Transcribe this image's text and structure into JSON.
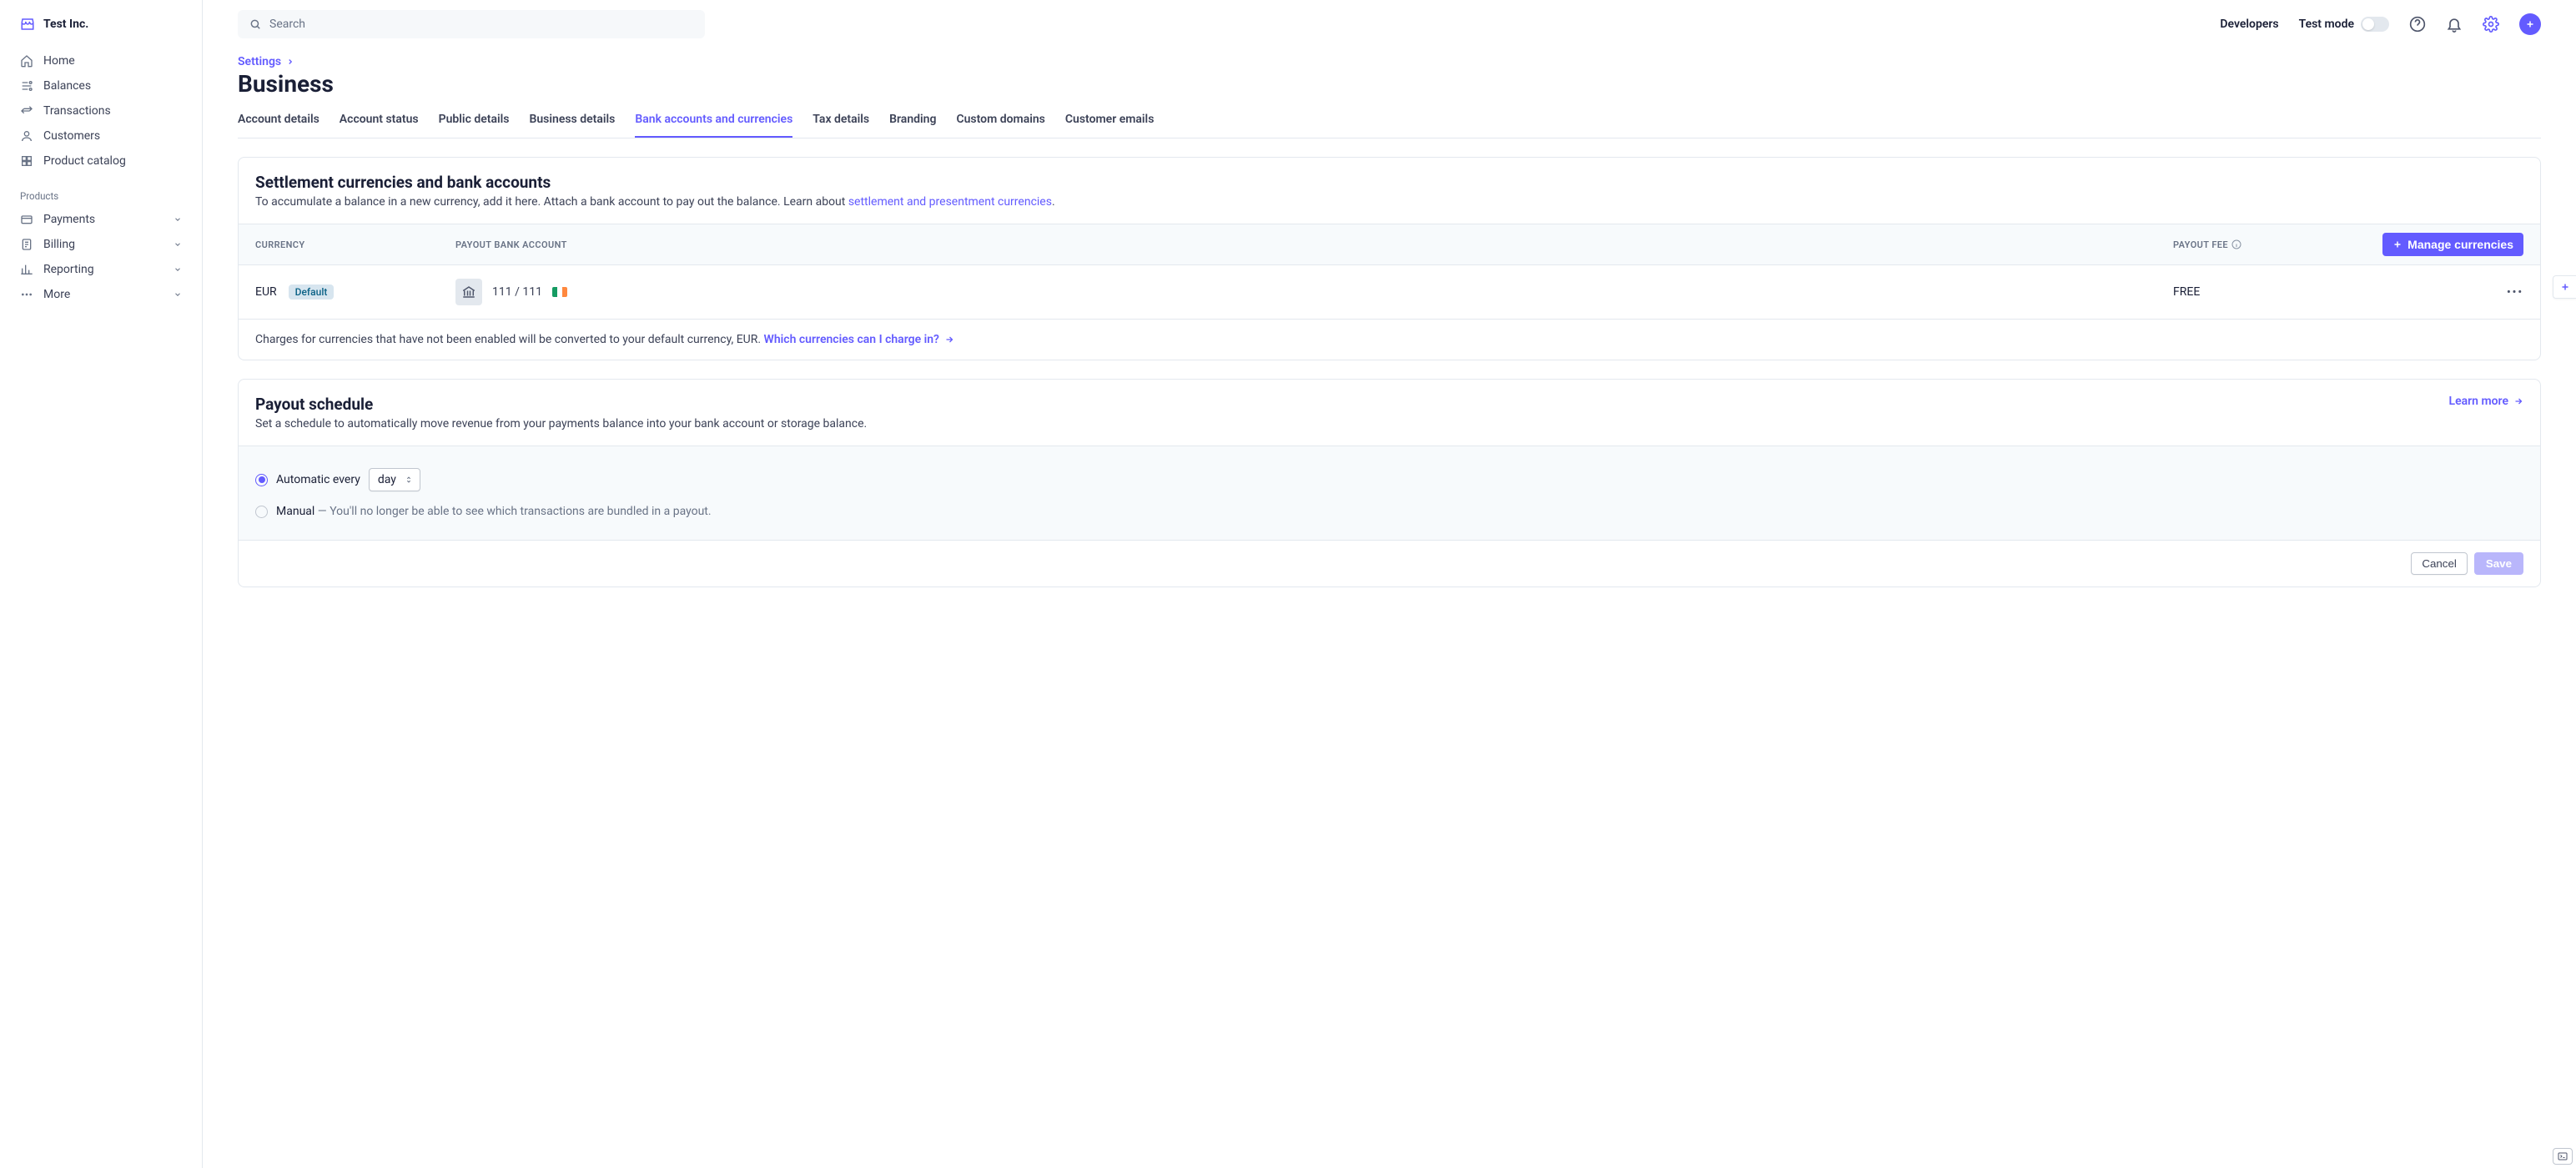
{
  "org_name": "Test Inc.",
  "search": {
    "placeholder": "Search"
  },
  "topbar": {
    "developers": "Developers",
    "test_mode": "Test mode"
  },
  "sidebar": {
    "items": [
      {
        "label": "Home"
      },
      {
        "label": "Balances"
      },
      {
        "label": "Transactions"
      },
      {
        "label": "Customers"
      },
      {
        "label": "Product catalog"
      }
    ],
    "products_label": "Products",
    "products": [
      {
        "label": "Payments"
      },
      {
        "label": "Billing"
      },
      {
        "label": "Reporting"
      },
      {
        "label": "More"
      }
    ]
  },
  "breadcrumb": {
    "settings": "Settings"
  },
  "page_title": "Business",
  "tabs": [
    {
      "label": "Account details"
    },
    {
      "label": "Account status"
    },
    {
      "label": "Public details"
    },
    {
      "label": "Business details"
    },
    {
      "label": "Bank accounts and currencies",
      "active": true
    },
    {
      "label": "Tax details"
    },
    {
      "label": "Branding"
    },
    {
      "label": "Custom domains"
    },
    {
      "label": "Customer emails"
    }
  ],
  "settlement": {
    "title": "Settlement currencies and bank accounts",
    "desc_prefix": "To accumulate a balance in a new currency, add it here. Attach a bank account to pay out the balance. Learn about ",
    "desc_link": "settlement and presentment currencies",
    "desc_suffix": ".",
    "columns": {
      "currency": "CURRENCY",
      "bank": "PAYOUT BANK ACCOUNT",
      "fee": "PAYOUT FEE"
    },
    "manage_btn": "Manage currencies",
    "rows": [
      {
        "currency": "EUR",
        "default_badge": "Default",
        "bank_display": "111  /  111",
        "fee": "FREE"
      }
    ],
    "footer_prefix": "Charges for currencies that have not been enabled will be converted to your default currency, EUR. ",
    "footer_link": "Which currencies can I charge in?"
  },
  "payout": {
    "title": "Payout schedule",
    "desc": "Set a schedule to automatically move revenue from your payments balance into your bank account or storage balance.",
    "learn_more": "Learn more",
    "automatic_label": "Automatic every",
    "interval": "day",
    "manual_label": "Manual",
    "manual_note": " — You'll no longer be able to see which transactions are bundled in a payout.",
    "cancel": "Cancel",
    "save": "Save"
  }
}
